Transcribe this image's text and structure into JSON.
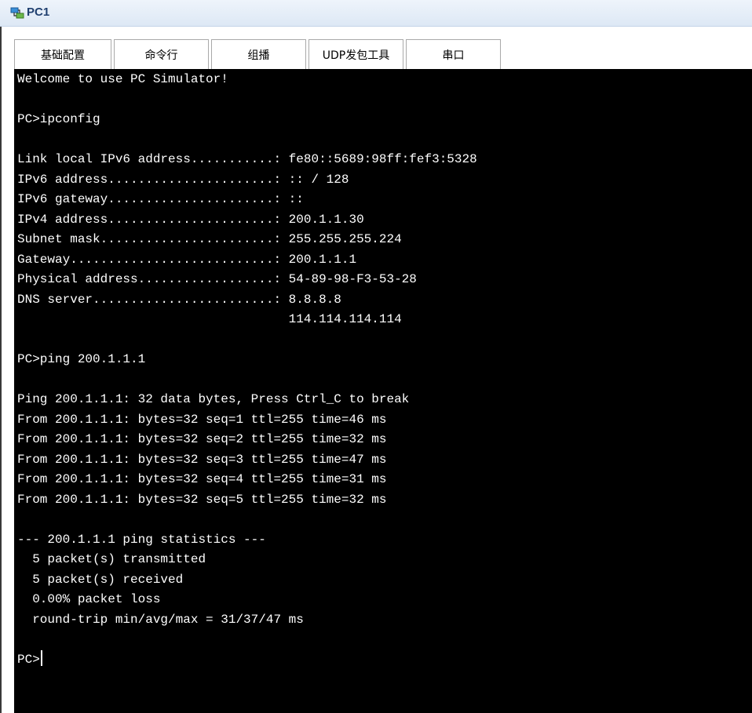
{
  "window": {
    "title": "PC1"
  },
  "tabs": [
    {
      "label": "基础配置",
      "name": "tab-basic-config"
    },
    {
      "label": "命令行",
      "name": "tab-command-line",
      "active": true
    },
    {
      "label": "组播",
      "name": "tab-multicast"
    },
    {
      "label": "UDP发包工具",
      "name": "tab-udp-tool"
    },
    {
      "label": "串口",
      "name": "tab-serial"
    }
  ],
  "terminal": {
    "lines": [
      "Welcome to use PC Simulator!",
      "",
      "PC>ipconfig",
      "",
      "Link local IPv6 address...........: fe80::5689:98ff:fef3:5328",
      "IPv6 address......................: :: / 128",
      "IPv6 gateway......................: ::",
      "IPv4 address......................: 200.1.1.30",
      "Subnet mask.......................: 255.255.255.224",
      "Gateway...........................: 200.1.1.1",
      "Physical address..................: 54-89-98-F3-53-28",
      "DNS server........................: 8.8.8.8",
      "                                    114.114.114.114",
      "",
      "PC>ping 200.1.1.1",
      "",
      "Ping 200.1.1.1: 32 data bytes, Press Ctrl_C to break",
      "From 200.1.1.1: bytes=32 seq=1 ttl=255 time=46 ms",
      "From 200.1.1.1: bytes=32 seq=2 ttl=255 time=32 ms",
      "From 200.1.1.1: bytes=32 seq=3 ttl=255 time=47 ms",
      "From 200.1.1.1: bytes=32 seq=4 ttl=255 time=31 ms",
      "From 200.1.1.1: bytes=32 seq=5 ttl=255 time=32 ms",
      "",
      "--- 200.1.1.1 ping statistics ---",
      "  5 packet(s) transmitted",
      "  5 packet(s) received",
      "  0.00% packet loss",
      "  round-trip min/avg/max = 31/37/47 ms",
      "",
      "PC>"
    ],
    "prompt_line_index": 29
  },
  "colors": {
    "terminal_bg": "#000000",
    "terminal_fg": "#ffffff",
    "title_text": "#1f3f6f"
  },
  "icons": {
    "title_icon": "pc-network-icon"
  }
}
